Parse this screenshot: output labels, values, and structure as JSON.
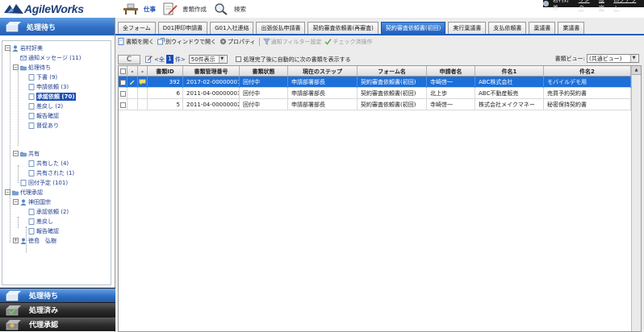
{
  "header": {
    "logo_text": "AgileWorks",
    "nav": [
      {
        "label": "仕事",
        "icon": "desk-icon"
      },
      {
        "label": "書類作成",
        "icon": "document-pen-icon"
      },
      {
        "label": "検索",
        "icon": "magnifier-icon"
      }
    ],
    "user_name": "岩村好美",
    "links": [
      "リンク",
      "設定",
      "ログアウト"
    ]
  },
  "sidebar": {
    "title": "処理待ち",
    "tree": {
      "root": "岩村好美",
      "notice": "通知メッセージ (11)",
      "pending_group": "処理待ち",
      "pending_items": [
        "下書 (9)",
        "申請依頼 (3)",
        "承認依頼 (70)",
        "差戻し (2)",
        "報告確認",
        "督促あり"
      ],
      "shared_group": "共有",
      "shared_items": [
        "共有した (4)",
        "共有された (1)"
      ],
      "scheduled": "回付予定 (101)",
      "proxy_group": "代理承認",
      "proxy_person": "神田国宗",
      "proxy_items": [
        "承認依頼 (2)",
        "差戻し",
        "報告確認"
      ],
      "other_person": "徳島　弘樹"
    },
    "bottom": [
      {
        "label": "処理待ち",
        "icon": "inbox-icon",
        "active": true
      },
      {
        "label": "処理済み",
        "icon": "done-box-icon",
        "active": false
      },
      {
        "label": "代理承認",
        "icon": "proxy-box-icon",
        "active": false
      }
    ]
  },
  "tabs": [
    "全フォーム",
    "D01押印申請書",
    "G01入社連絡",
    "出張仮払申請書",
    "契約審査依頼書(再審査)",
    "契約審査依頼書(初回)",
    "実行稟議書",
    "支払依頼書",
    "稟議書",
    "業議書"
  ],
  "active_tab": 5,
  "toolbar": {
    "open": "書類を開く",
    "open_new_window": "別ウィンドウで開く",
    "properties": "プロパティ",
    "notify_filter": "通知フィルター設定",
    "check_batch": "チェック済操作"
  },
  "list_controls": {
    "refresh": "C",
    "all_prefix": "<全",
    "all_suffix": "件>",
    "page": "1",
    "per_page": "50件表示",
    "auto_show_label": "処理完了後に自動的に次の書類を表示する",
    "view_label": "書類ビュー:",
    "view_value": "(共通ビュー)"
  },
  "table": {
    "columns": [
      "",
      "",
      "",
      "書類ID",
      "書類管理番号",
      "書類状態",
      "現在のステップ",
      "フォーム名",
      "申請者名",
      "件名1",
      "件名2"
    ],
    "rows": [
      {
        "id": "392",
        "number": "2017-02-00000001",
        "status": "回付中",
        "step": "申請部署部長",
        "form": "契約審査依頼書(初回)",
        "applicant": "寺崎啓一",
        "subject1": "ABC株式会社",
        "subject2": "モバイルデモ用"
      },
      {
        "id": "6",
        "number": "2011-04-00000003",
        "status": "回付中",
        "step": "申請部署部長",
        "form": "契約審査依頼書(初回)",
        "applicant": "北上歩",
        "subject1": "ABC不動産販売",
        "subject2": "売買予約契約書"
      },
      {
        "id": "5",
        "number": "2011-04-00000002",
        "status": "回付中",
        "step": "申請部署部長",
        "form": "契約審査依頼書(初回)",
        "applicant": "寺崎啓一",
        "subject1": "株式会社メイクマネー",
        "subject2": "秘密保持契約書"
      }
    ]
  },
  "colors": {
    "brand": "#1d3e7a",
    "accent": "#1f5fbf",
    "selected_row": "#1d6fd9"
  }
}
